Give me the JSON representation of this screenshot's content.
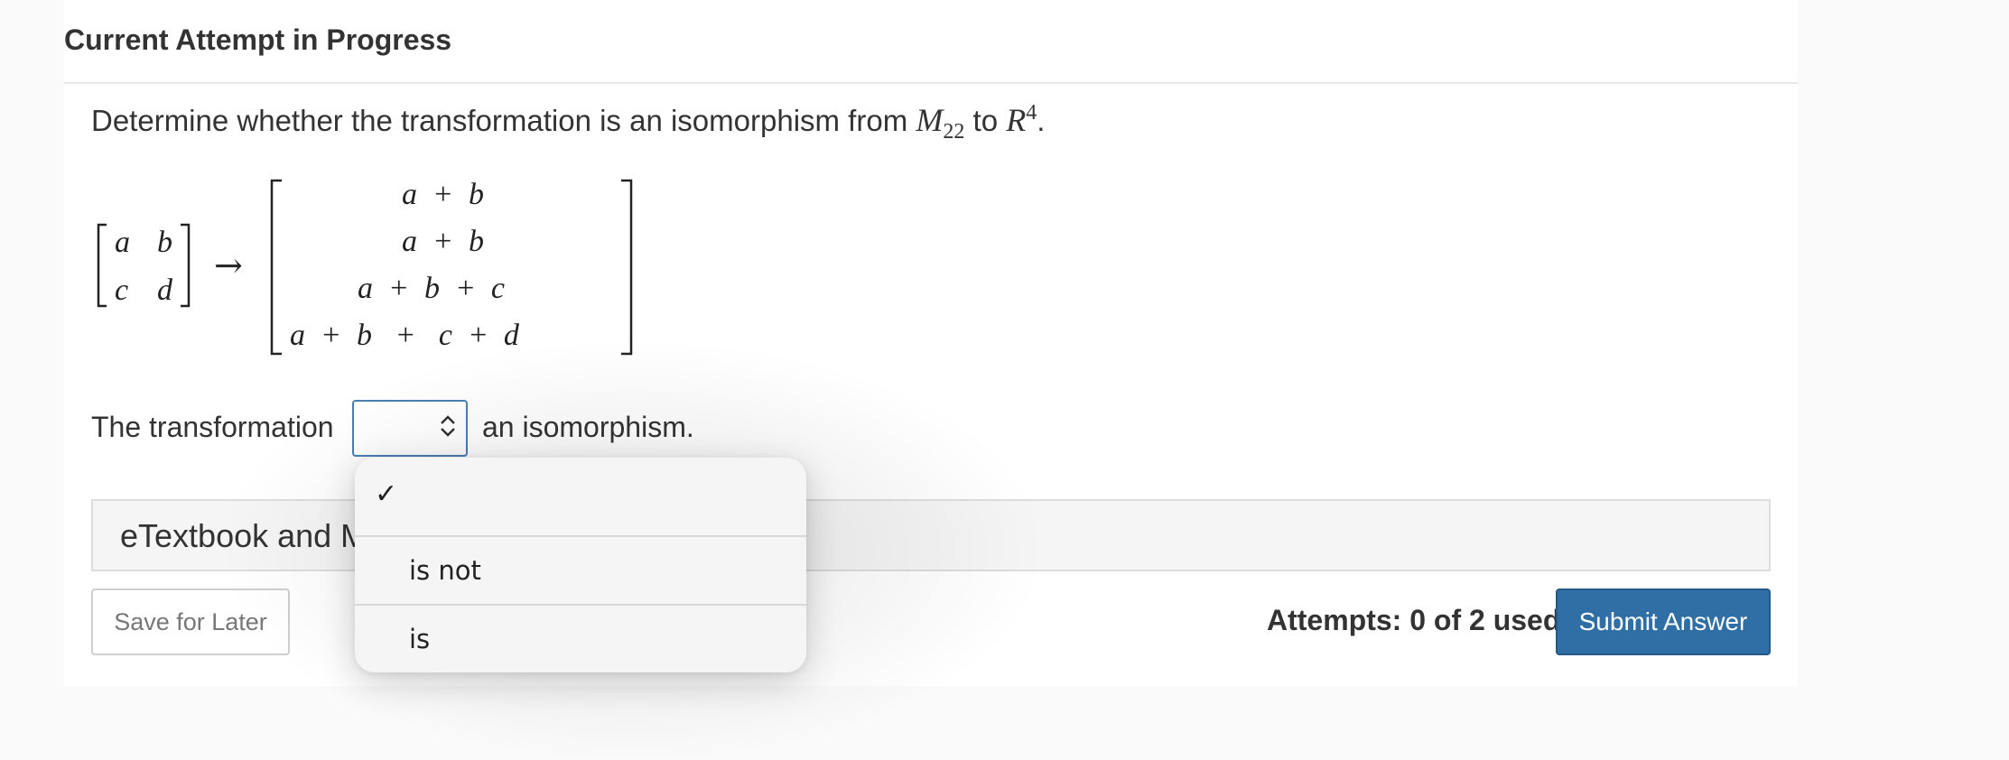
{
  "header": {
    "title": "Current Attempt in Progress"
  },
  "question": {
    "prefix": "Determine whether the transformation is an isomorphism from",
    "domain_symbol": "M",
    "domain_sub": "22",
    "to_word": "to",
    "codomain_symbol": "R",
    "codomain_sup": "4",
    "period": "."
  },
  "matrix": {
    "input": {
      "a": "a",
      "b": "b",
      "c": "c",
      "d": "d"
    },
    "arrow": "→",
    "output_rows": [
      "a  +  b",
      "a  +  b",
      "a  +  b  +  c",
      "a  +  b   +   c  +  d"
    ]
  },
  "answer": {
    "prefix": "The transformation",
    "suffix": "an isomorphism.",
    "selected": "",
    "chevron": "updown-chevron-icon"
  },
  "dropdown": {
    "check_mark": "✓",
    "options": [
      "",
      "is not",
      "is"
    ]
  },
  "etextbook": {
    "label": "eTextbook and M"
  },
  "footer": {
    "save_label": "Save for Later",
    "attempts_text": "Attempts: 0 of 2 used",
    "submit_label": "Submit Answer"
  },
  "colors": {
    "submit_bg": "#2f6fa6",
    "select_border": "#4b7fb5",
    "dropdown_bg": "#f5f5f5"
  }
}
